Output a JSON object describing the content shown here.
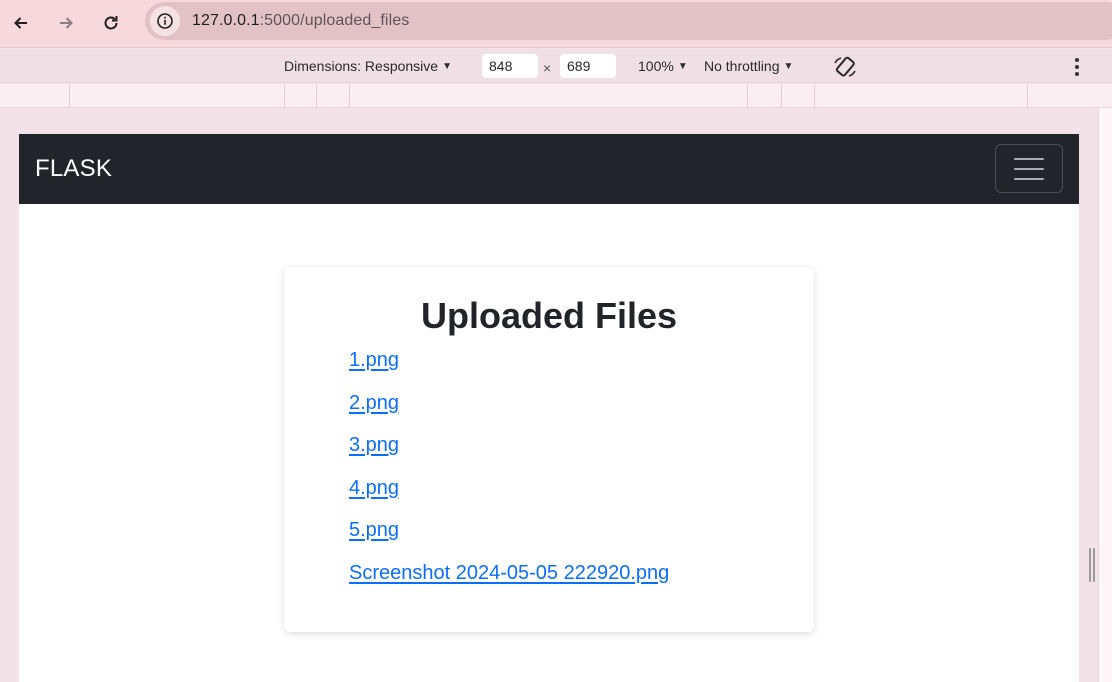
{
  "browser": {
    "url_host": "127.0.0.1",
    "url_path": ":5000/uploaded_files"
  },
  "devtools": {
    "dimensions_label": "Dimensions: Responsive",
    "width": "848",
    "height": "689",
    "times": "×",
    "zoom": "100%",
    "throttling": "No throttling"
  },
  "navbar": {
    "brand": "FLASK"
  },
  "main": {
    "title": "Uploaded Files",
    "files": [
      "1.png",
      "2.png",
      "3.png",
      "4.png",
      "5.png",
      "Screenshot 2024-05-05 222920.png"
    ]
  },
  "colors": {
    "navbar_bg": "#212529",
    "link": "#0d6efd",
    "browser_bar": "#f6d8dd"
  }
}
